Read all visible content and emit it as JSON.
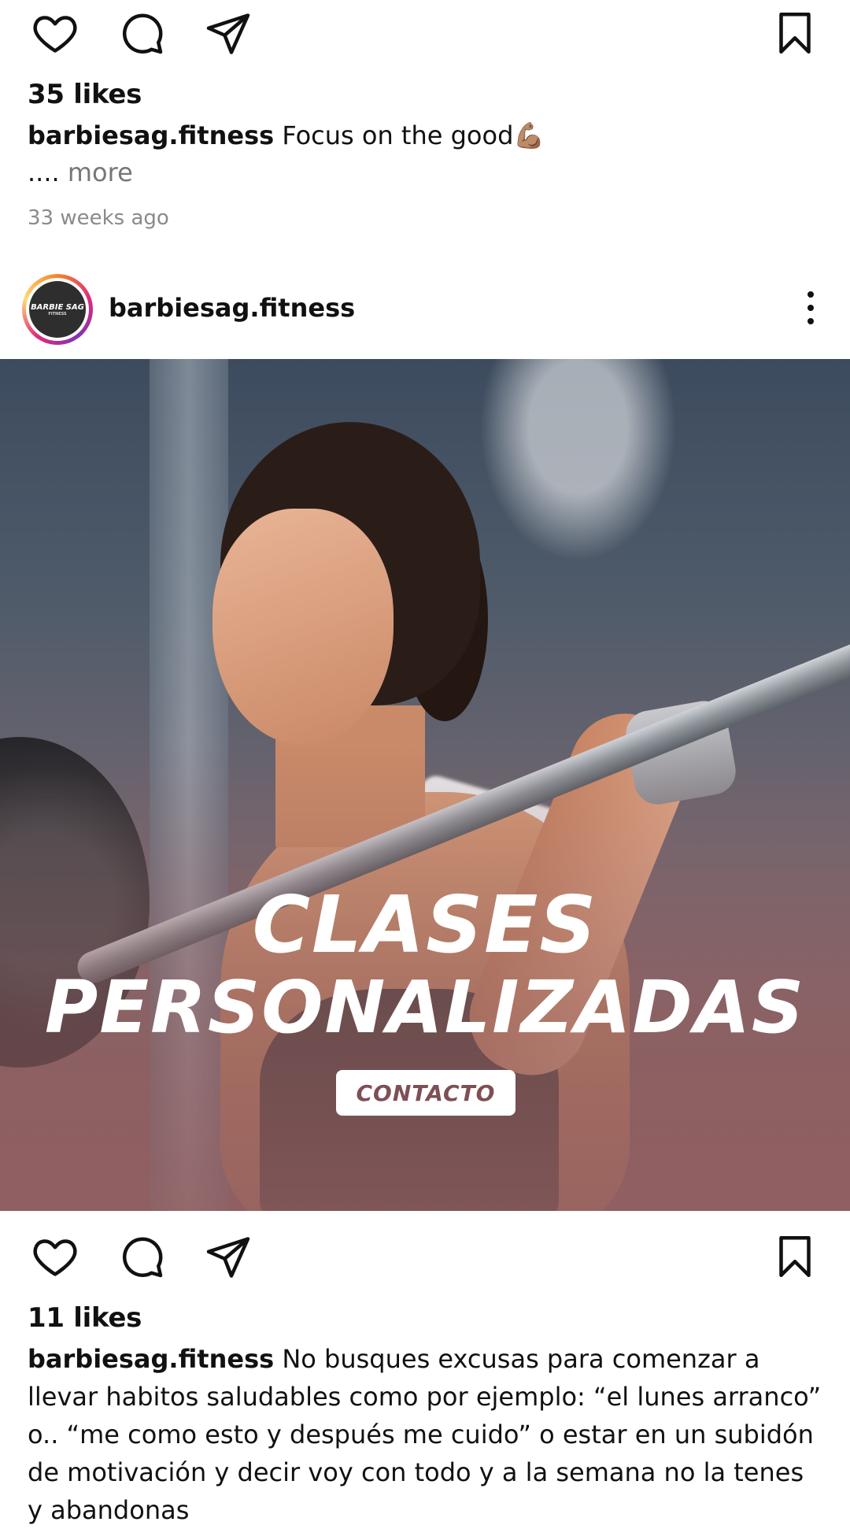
{
  "post1": {
    "likes": "35 likes",
    "caption_user": "barbiesag.fitness",
    "caption_text": " Focus on the good💪🏽",
    "more_dots": "....",
    "more_label": " more",
    "time": "33 weeks ago"
  },
  "post2": {
    "username": "barbiesag.fitness",
    "avatar_text": "BARBIE SAG",
    "avatar_sub": "FITNESS",
    "promo_line1": "CLASES",
    "promo_line2": "PERSONALIZADAS",
    "cta_label": "CONTACTO",
    "likes": "11 likes",
    "caption_user": "barbiesag.fitness",
    "caption_text": " No busques excusas para comenzar a llevar habitos saludables como por ejemplo: “el lunes arranco” o.. “me como esto y después me cuido” o estar en un subidón de motivación y decir voy con todo y a la semana no la tenes y abandonas"
  },
  "icons": [
    "heart-icon",
    "comment-icon",
    "share-icon",
    "bookmark-icon",
    "more-options-icon"
  ]
}
